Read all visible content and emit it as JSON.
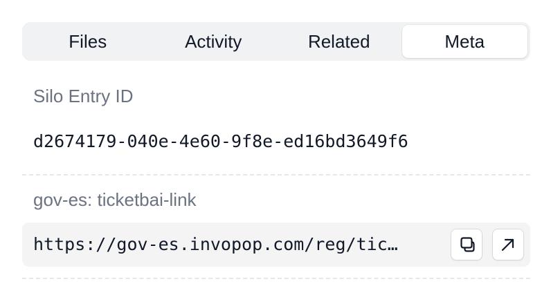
{
  "tabs": [
    {
      "label": "Files",
      "active": false
    },
    {
      "label": "Activity",
      "active": false
    },
    {
      "label": "Related",
      "active": false
    },
    {
      "label": "Meta",
      "active": true
    }
  ],
  "meta": {
    "silo_entry": {
      "label": "Silo Entry ID",
      "value": "d2674179-040e-4e60-9f8e-ed16bd3649f6"
    },
    "ticketbai_link": {
      "label": "gov-es: ticketbai-link",
      "value": "https://gov-es.invopop.com/reg/tic…",
      "actions": {
        "copy_icon": "copy-icon",
        "open_icon": "external-link-icon"
      }
    }
  },
  "colors": {
    "tab_bar_bg": "#f1f2f3",
    "active_tab_bg": "#ffffff",
    "label_text": "#6b7280",
    "value_text": "#111827",
    "divider": "#e5e7eb",
    "link_row_bg": "#f4f4f5"
  }
}
